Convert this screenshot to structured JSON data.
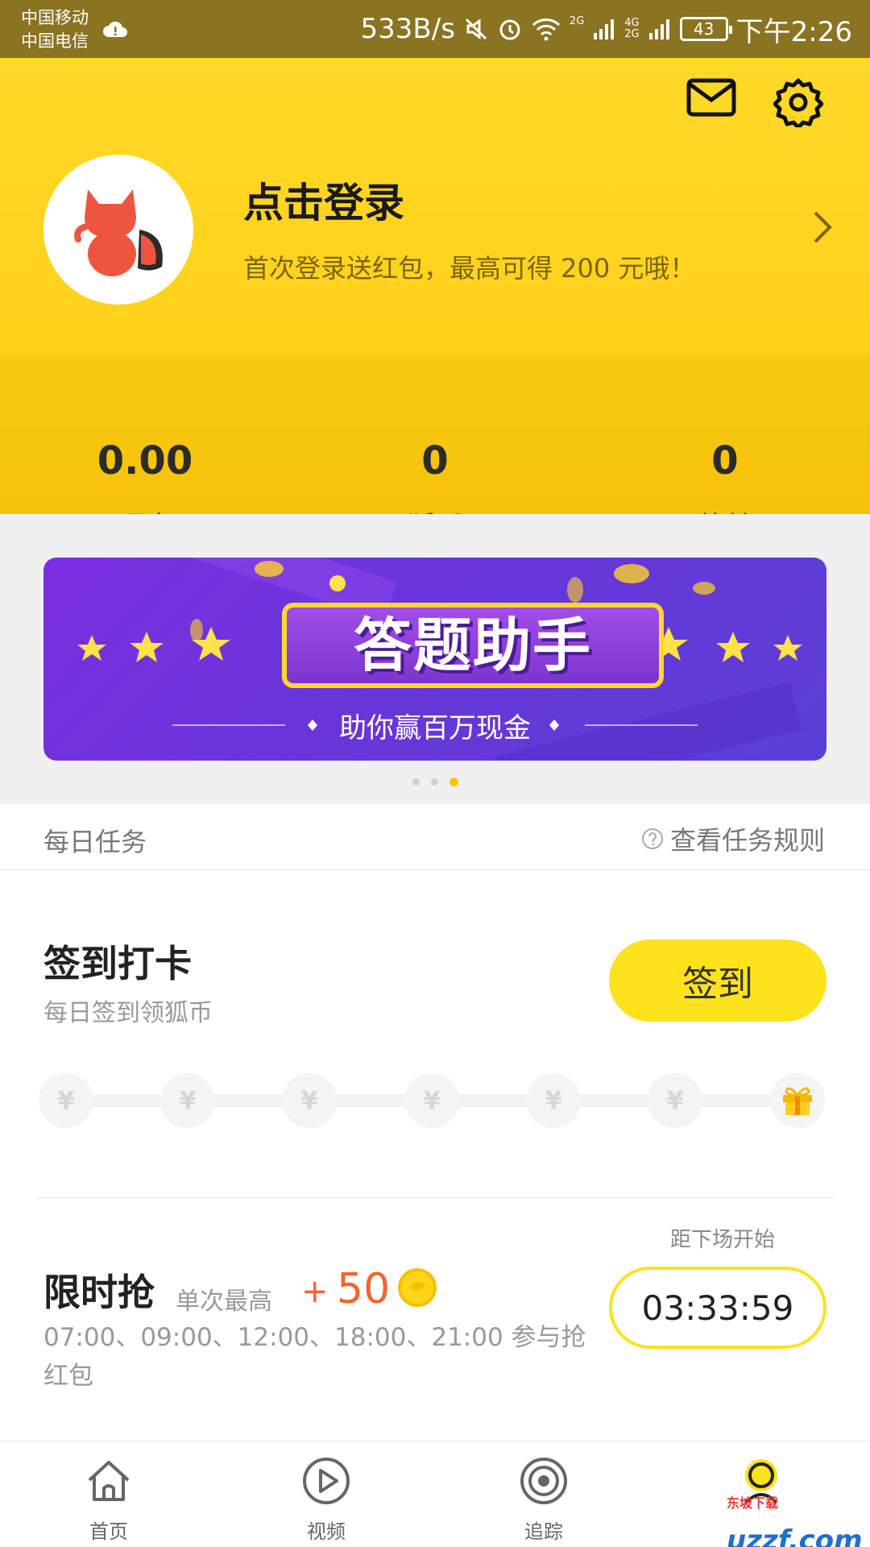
{
  "status_bar": {
    "carrier_1": "中国移动",
    "carrier_2": "中国电信",
    "speed": "533B/s",
    "net_1": "2G",
    "net_2_top": "4G",
    "net_2_bottom": "2G",
    "battery": "43",
    "time": "下午2:26"
  },
  "header": {
    "login_title": "点击登录",
    "login_subtitle": "首次登录送红包，最高可得 200 元哦！",
    "stats": [
      {
        "value": "0.00",
        "label": "现金"
      },
      {
        "value": "0",
        "label": "狐币"
      },
      {
        "value": "0",
        "label": "徒弟"
      }
    ]
  },
  "banner": {
    "title": "答题助手",
    "subtitle": "助你赢百万现金",
    "slide_count": 3,
    "active_slide": 3
  },
  "tasks": {
    "section_title": "每日任务",
    "rules_link": "查看任务规则",
    "checkin": {
      "title": "签到打卡",
      "subtitle": "每日签到领狐币",
      "button": "签到",
      "coin_symbol": "¥"
    },
    "flash": {
      "next_label": "距下场开始",
      "title": "限时抢",
      "max_label": "单次最高",
      "plus": "+",
      "amount": "50",
      "times": "07:00、09:00、12:00、18:00、21:00 参与抢红包",
      "countdown": "03:33:59"
    }
  },
  "bottom_nav": [
    {
      "label": "首页"
    },
    {
      "label": "视频"
    },
    {
      "label": "追踪"
    },
    {
      "label": ""
    }
  ],
  "watermark": {
    "brand": "uzzf.com",
    "small": "东坡下载"
  },
  "colors": {
    "accent_yellow": "#fde21c",
    "orange": "#f0662d",
    "banner_purple": "#6736d8"
  }
}
